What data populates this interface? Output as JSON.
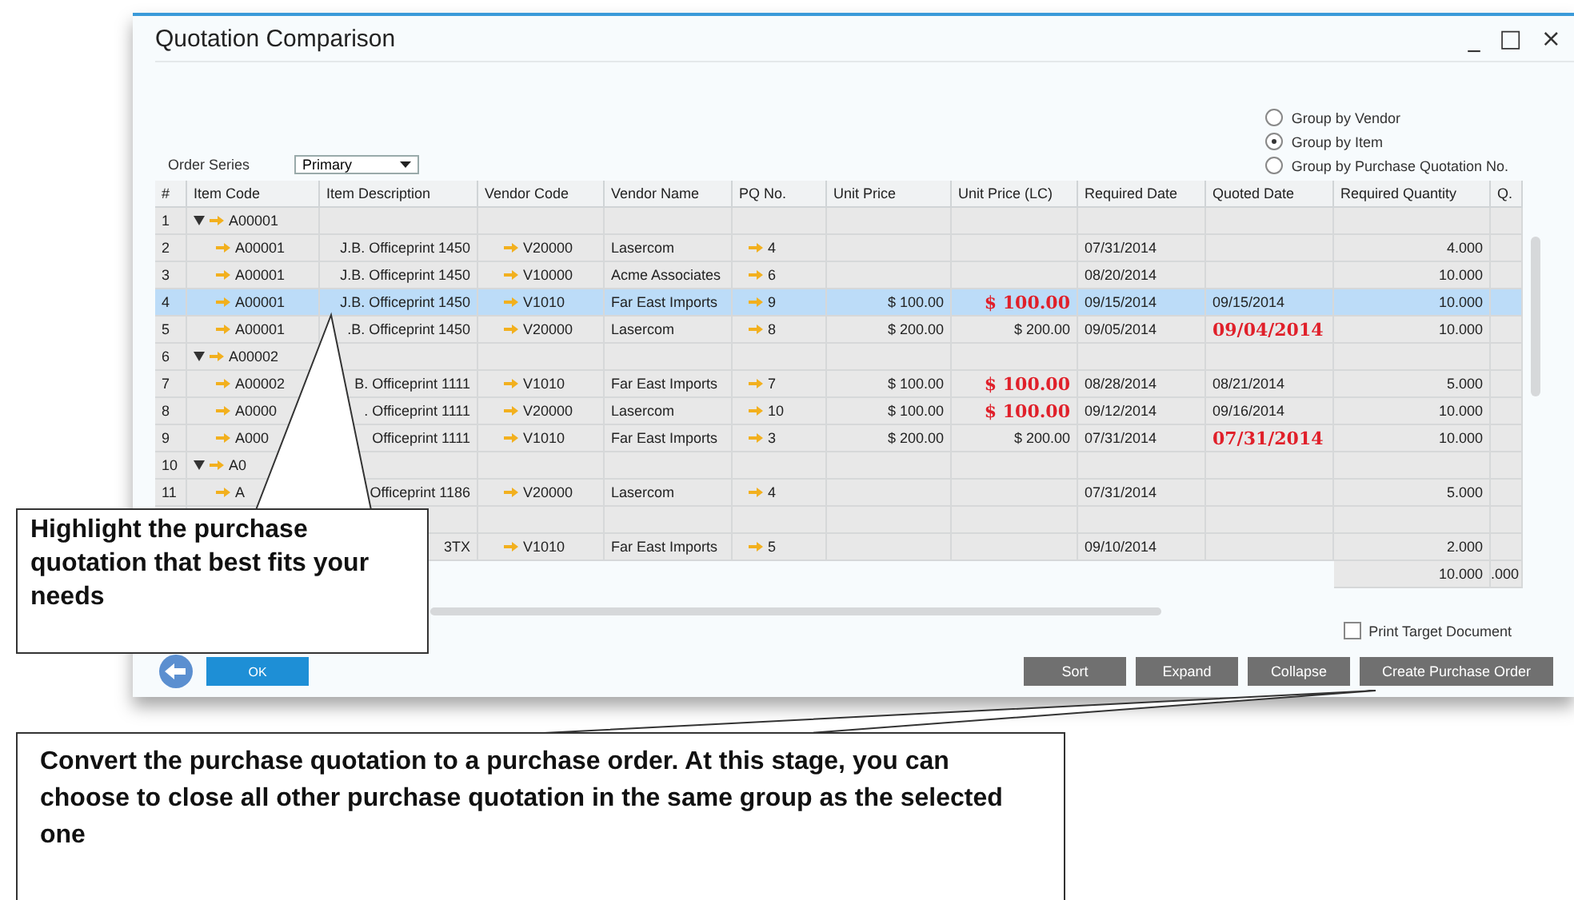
{
  "window": {
    "title": "Quotation Comparison",
    "controls": [
      "_",
      "□",
      "×"
    ]
  },
  "grouping": [
    {
      "label": "Group by Vendor",
      "selected": false
    },
    {
      "label": "Group by Item",
      "selected": true
    },
    {
      "label": "Group by Purchase Quotation No.",
      "selected": false
    }
  ],
  "order_series": {
    "label": "Order Series",
    "value": "Primary"
  },
  "table": {
    "columns": [
      "#",
      "Item Code",
      "Item Description",
      "Vendor Code",
      "Vendor Name",
      "PQ No.",
      "Unit Price",
      "Unit Price (LC)",
      "Required Date",
      "Quoted Date",
      "Required Quantity",
      "Q."
    ],
    "rows": [
      {
        "kind": "group",
        "num": "1",
        "item_code": "A00001",
        "expanded": true,
        "selected": false
      },
      {
        "kind": "item",
        "num": "2",
        "item_code": "A00001",
        "description": "J.B. Officeprint 1450",
        "vendor_code": "V20000",
        "vendor_name": "Lasercom",
        "pq_no": "4",
        "required_date": "07/31/2014",
        "required_quantity": "4.000",
        "lc_best": false,
        "date_best": false,
        "selected": false
      },
      {
        "kind": "item",
        "num": "3",
        "item_code": "A00001",
        "description": "J.B. Officeprint 1450",
        "vendor_code": "V10000",
        "vendor_name": "Acme Associates",
        "pq_no": "6",
        "required_date": "08/20/2014",
        "required_quantity": "10.000",
        "lc_best": false,
        "date_best": false,
        "selected": false
      },
      {
        "kind": "item",
        "num": "4",
        "item_code": "A00001",
        "description": "J.B. Officeprint 1450",
        "vendor_code": "V1010",
        "vendor_name": "Far East Imports",
        "pq_no": "9",
        "unit_price": "$ 100.00",
        "unit_price_lc": "$ 100.00",
        "required_date": "09/15/2014",
        "quoted_date": "09/15/2014",
        "required_quantity": "10.000",
        "lc_best": true,
        "date_best": false,
        "selected": true
      },
      {
        "kind": "item",
        "num": "5",
        "item_code": "A00001",
        "description": ".B. Officeprint 1450",
        "vendor_code": "V20000",
        "vendor_name": "Lasercom",
        "pq_no": "8",
        "unit_price": "$ 200.00",
        "unit_price_lc": "$ 200.00",
        "required_date": "09/05/2014",
        "quoted_date": "09/04/2014",
        "required_quantity": "10.000",
        "lc_best": false,
        "date_best": true,
        "selected": false
      },
      {
        "kind": "group",
        "num": "6",
        "item_code": "A00002",
        "expanded": true,
        "selected": false
      },
      {
        "kind": "item",
        "num": "7",
        "item_code": "A00002",
        "description": "B. Officeprint 1111",
        "vendor_code": "V1010",
        "vendor_name": "Far East Imports",
        "pq_no": "7",
        "unit_price": "$ 100.00",
        "unit_price_lc": "$ 100.00",
        "required_date": "08/28/2014",
        "quoted_date": "08/21/2014",
        "required_quantity": "5.000",
        "lc_best": true,
        "date_best": false,
        "selected": false
      },
      {
        "kind": "item",
        "num": "8",
        "item_code": "A0000",
        "description": ". Officeprint 1111",
        "vendor_code": "V20000",
        "vendor_name": "Lasercom",
        "pq_no": "10",
        "unit_price": "$ 100.00",
        "unit_price_lc": "$ 100.00",
        "required_date": "09/12/2014",
        "quoted_date": "09/16/2014",
        "required_quantity": "10.000",
        "lc_best": true,
        "date_best": false,
        "selected": false
      },
      {
        "kind": "item",
        "num": "9",
        "item_code": "A000",
        "description": "Officeprint 1111",
        "vendor_code": "V1010",
        "vendor_name": "Far East Imports",
        "pq_no": "3",
        "unit_price": "$ 200.00",
        "unit_price_lc": "$ 200.00",
        "required_date": "07/31/2014",
        "quoted_date": "07/31/2014",
        "required_quantity": "10.000",
        "lc_best": false,
        "date_best": true,
        "selected": false
      },
      {
        "kind": "group",
        "num": "10",
        "item_code": "A0",
        "expanded": true,
        "selected": false
      },
      {
        "kind": "item",
        "num": "11",
        "item_code": "A",
        "description": "Officeprint 1186",
        "vendor_code": "V20000",
        "vendor_name": "Lasercom",
        "pq_no": "4",
        "required_date": "07/31/2014",
        "required_quantity": "5.000",
        "lc_best": false,
        "date_best": false,
        "selected": false
      },
      {
        "kind": "group",
        "selected": false
      },
      {
        "kind": "item",
        "description": "3TX",
        "vendor_code": "V1010",
        "vendor_name": "Far East Imports",
        "pq_no": "5",
        "required_date": "09/10/2014",
        "required_quantity": "2.000",
        "lc_best": false,
        "date_best": false,
        "selected": false
      }
    ],
    "totals": {
      "required_quantity": "10.000",
      "q": ".000"
    }
  },
  "print_target": {
    "label": "Print Target Document",
    "checked": false
  },
  "buttons": [
    "Sort",
    "Expand",
    "Collapse",
    "Create Purchase Order"
  ],
  "ok_button": "OK",
  "callouts": [
    {
      "text": "Highlight the purchase quotation that best fits your needs"
    },
    {
      "text": "Convert the purchase quotation to a purchase order. At this stage, you can choose to close all other purchase quotation in the same group as the selected one"
    }
  ]
}
